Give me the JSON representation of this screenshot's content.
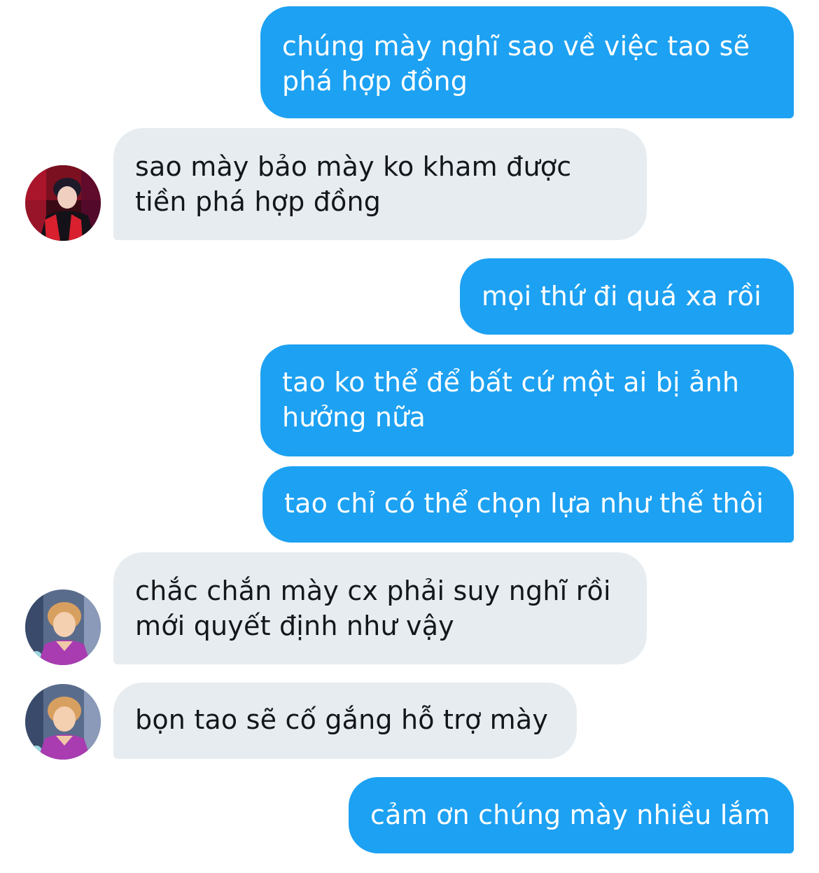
{
  "conversation": {
    "messages": [
      {
        "side": "outgoing",
        "lines": [
          "chúng mày nghĩ sao về việc tao sẽ",
          "phá hợp đồng"
        ]
      },
      {
        "side": "incoming",
        "sender_avatar": "avatar-red-stage",
        "lines": [
          "sao mày bảo mày ko kham được",
          "tiền phá hợp đồng"
        ]
      },
      {
        "side": "outgoing",
        "lines": [
          "mọi thứ đi quá xa rồi"
        ]
      },
      {
        "side": "outgoing",
        "lines": [
          "tao ko thể để bất cứ một ai bị ảnh",
          "hưởng nữa"
        ]
      },
      {
        "side": "outgoing",
        "lines": [
          "tao chỉ có thể chọn lựa như thế thôi"
        ]
      },
      {
        "side": "incoming",
        "sender_avatar": "avatar-purple-blond",
        "lines": [
          "chắc chắn mày cx phải suy nghĩ rồi",
          "mới quyết định như vậy"
        ]
      },
      {
        "side": "incoming",
        "sender_avatar": "avatar-purple-blond",
        "lines": [
          "bọn tao sẽ cố gắng hỗ trợ mày"
        ]
      },
      {
        "side": "outgoing",
        "lines": [
          "cảm ơn chúng mày nhiều lắm"
        ]
      }
    ]
  },
  "colors": {
    "outgoing_bubble": "#1da1f2",
    "incoming_bubble": "#e6ecf0",
    "outgoing_text": "#ffffff",
    "incoming_text": "#14171a"
  }
}
